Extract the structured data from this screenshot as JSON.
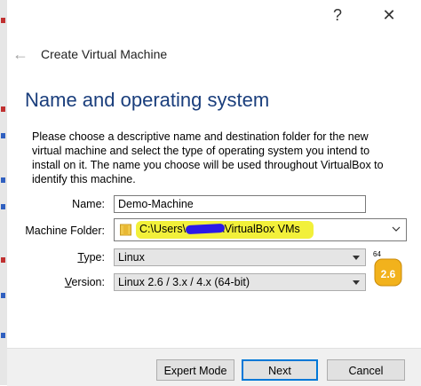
{
  "window": {
    "help_glyph": "?",
    "close_glyph": "✕"
  },
  "header": {
    "back_glyph": "←",
    "title": "Create Virtual Machine"
  },
  "section": {
    "title": "Name and operating system"
  },
  "description": "Please choose a descriptive name and destination folder for the new virtual machine and select the type of operating system you intend to install on it. The name you choose will be used throughout VirtualBox to identify this machine.",
  "form": {
    "name_label": "Name:",
    "name_value": "Demo-Machine",
    "folder_label": "Machine Folder:",
    "folder_prefix": "C:\\Users\\",
    "folder_suffix": "\\VirtualBox VMs",
    "type_label_underlined": "T",
    "type_label_rest": "ype:",
    "type_value": "Linux",
    "version_label_underlined": "V",
    "version_label_rest": "ersion:",
    "version_value": "Linux 2.6 / 3.x / 4.x (64-bit)",
    "os_badge_bits": "64",
    "os_badge_version": "2.6"
  },
  "footer": {
    "expert_mode": "Expert Mode",
    "next": "Next",
    "cancel": "Cancel"
  },
  "colors": {
    "section_title": "#1a3e7c",
    "highlight": "#f2f03a",
    "redaction": "#2c1ae6",
    "default_button_border": "#0078d7"
  }
}
